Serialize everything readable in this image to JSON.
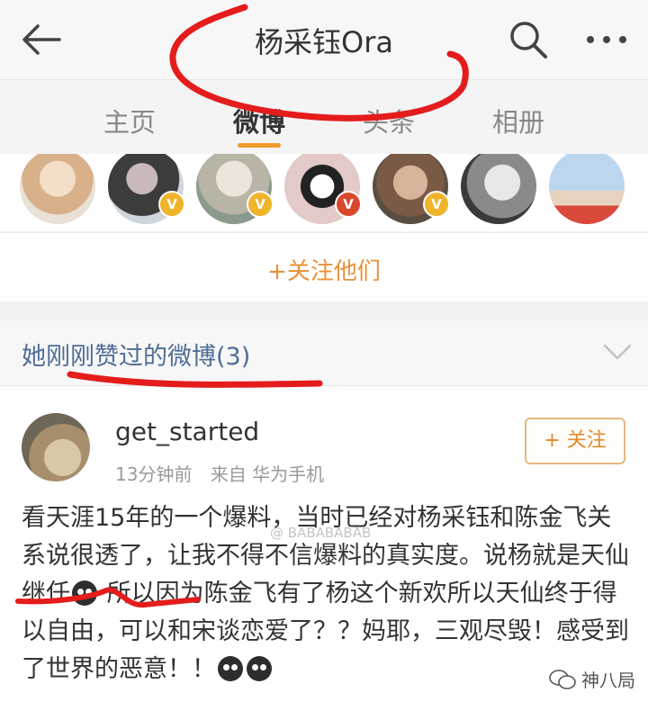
{
  "header": {
    "title": "杨采钰Ora",
    "back_icon": "back-arrow-icon",
    "search_icon": "search-icon",
    "more_icon": "more-icon"
  },
  "tabs": [
    {
      "label": "主页",
      "active": false
    },
    {
      "label": "微博",
      "active": true
    },
    {
      "label": "头条",
      "active": false
    },
    {
      "label": "相册",
      "active": false
    }
  ],
  "follow_them_label": "+关注他们",
  "section": {
    "title": "她刚刚赞过的微博(3)"
  },
  "post": {
    "username": "get_started",
    "time": "13分钟前",
    "source": "来自 华为手机",
    "follow_label": "+ 关注",
    "text_part1": "看天涯15年的一个爆料，当时已经对杨采钰和陈金飞关系说很透了，让我不得不信爆料的真实度。说杨就是天仙继任",
    "text_part2": " 所以因为陈金飞有了杨这个新欢所以天仙终于得以自由，可以和宋谈恋爱了？？妈耶，三观尽毁！感受到了世界的恶意！！"
  },
  "watermarks": {
    "weibo": "@ BABABABAB",
    "wechat": "神八局"
  },
  "colors": {
    "accent_orange": "#f19a2e",
    "link_blue": "#4f6d95",
    "annotation_red": "#e41c1c"
  }
}
